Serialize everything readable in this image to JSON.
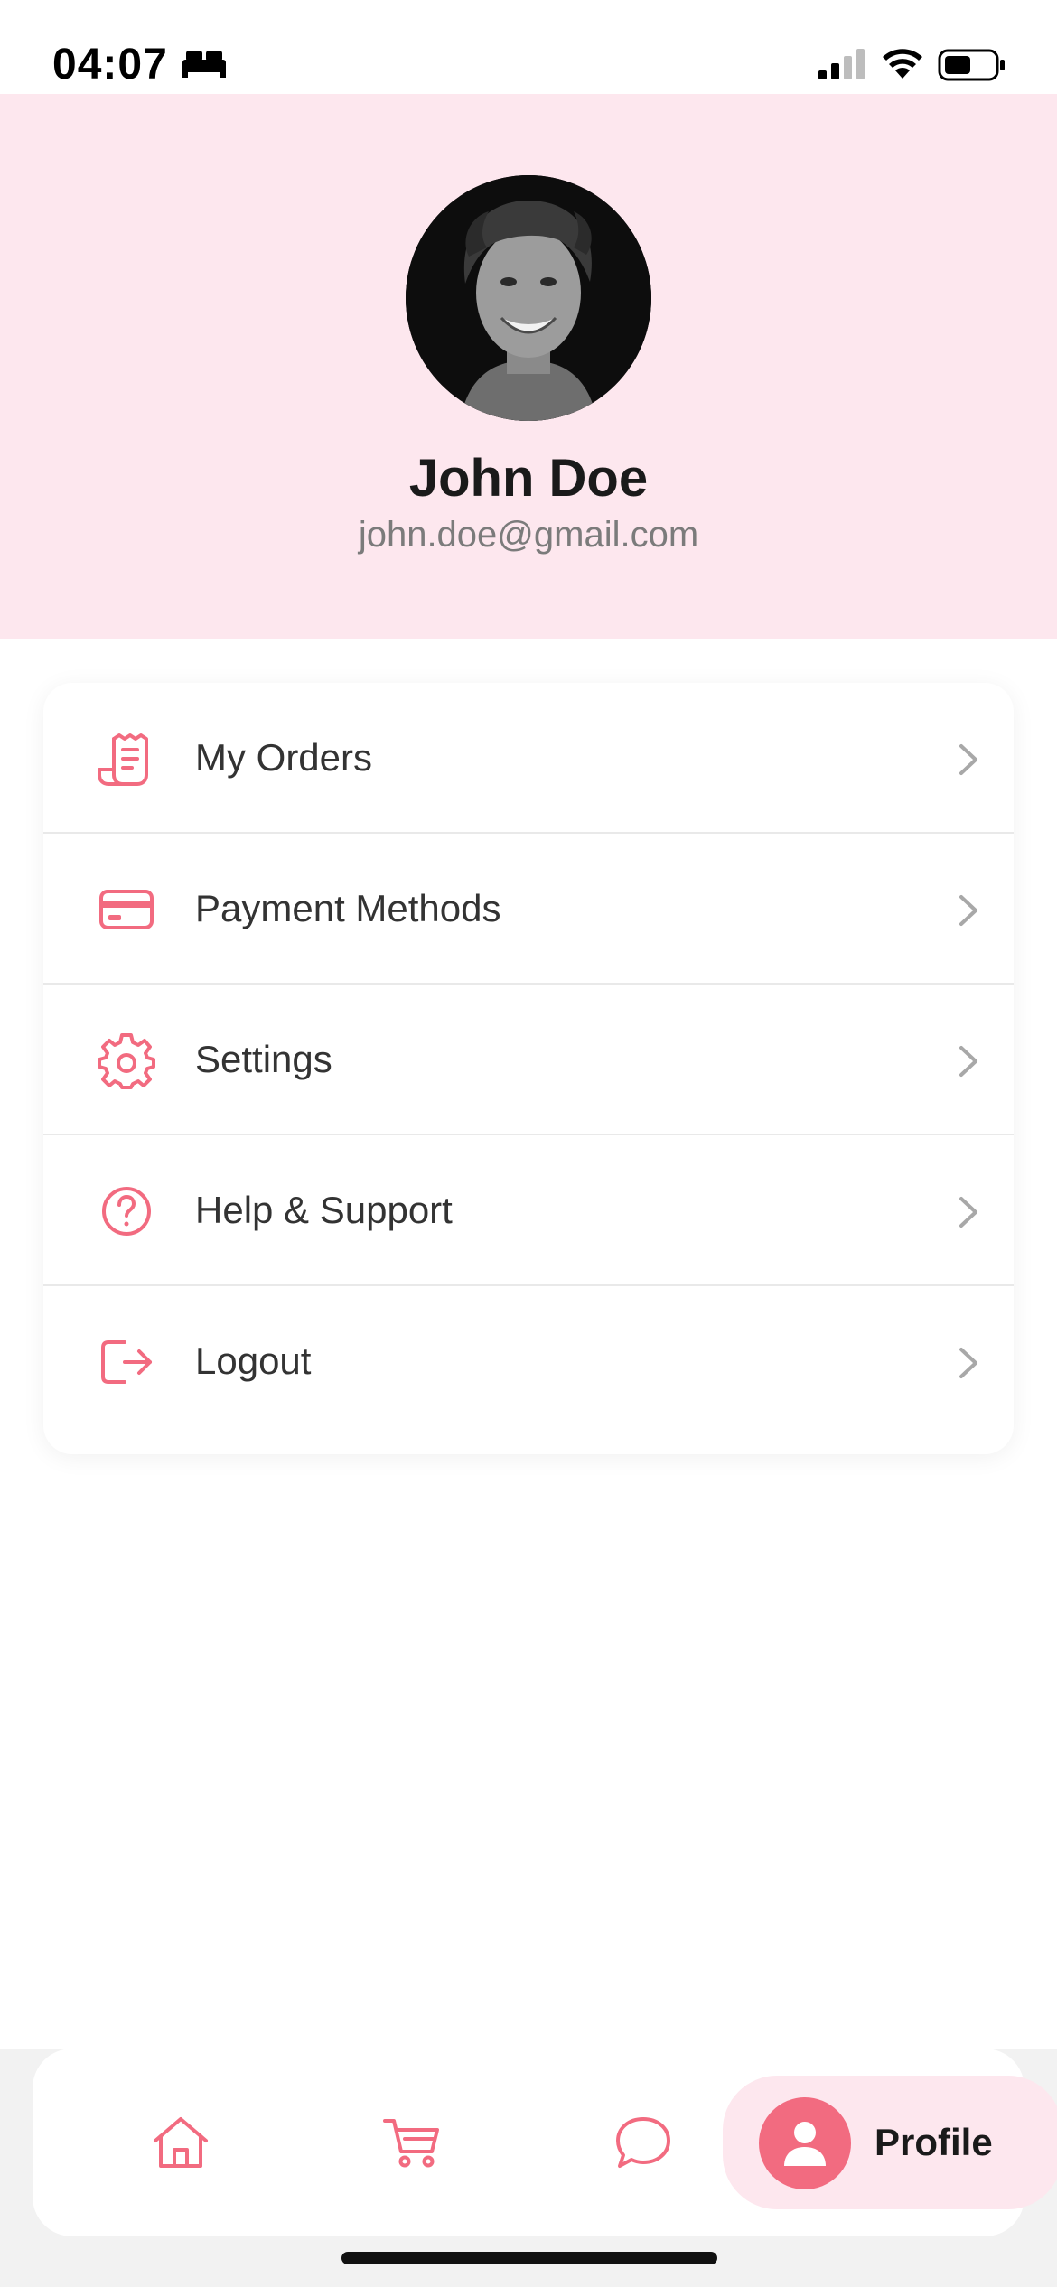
{
  "status_bar": {
    "time": "04:07",
    "icons": [
      "sleep-mode-icon",
      "cellular-signal-icon",
      "wifi-icon",
      "battery-icon"
    ]
  },
  "profile": {
    "name": "John Doe",
    "email": "john.doe@gmail.com",
    "avatar": "user-avatar-photo"
  },
  "menu": {
    "items": [
      {
        "label": "My Orders",
        "icon": "receipt-icon"
      },
      {
        "label": "Payment Methods",
        "icon": "credit-card-icon"
      },
      {
        "label": "Settings",
        "icon": "gear-icon"
      },
      {
        "label": "Help & Support",
        "icon": "question-circle-icon"
      },
      {
        "label": "Logout",
        "icon": "logout-icon"
      }
    ]
  },
  "bottom_nav": {
    "items": [
      {
        "name": "home",
        "icon": "home-icon"
      },
      {
        "name": "cart",
        "icon": "cart-icon"
      },
      {
        "name": "chat",
        "icon": "chat-bubble-icon"
      }
    ],
    "active": {
      "label": "Profile",
      "icon": "user-icon"
    }
  },
  "colors": {
    "accent": "#f26b80",
    "header_background": "#fde7ee",
    "active_pill_background": "#fde7ee",
    "chevron": "#a8a8a8"
  }
}
